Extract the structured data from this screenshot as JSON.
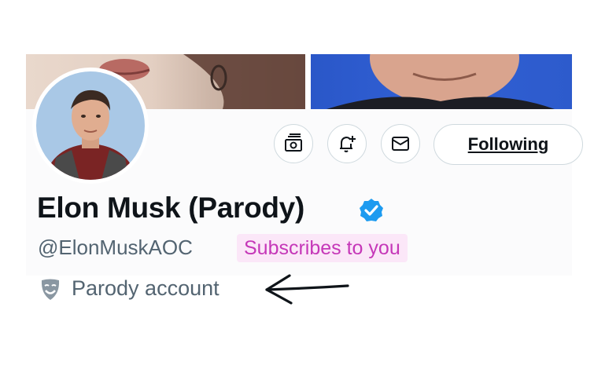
{
  "profile": {
    "display_name": "Elon Musk (Parody)",
    "handle": "@ElonMuskAOC",
    "subscribes_label": "Subscribes to you",
    "parody_label": "Parody account",
    "verified": true
  },
  "actions": {
    "following_label": "Following",
    "icons": [
      "subscription-icon",
      "notification-bell-icon",
      "message-icon"
    ]
  },
  "colors": {
    "verified_blue": "#1d9bf0",
    "subscribes_bg": "#fbe7f8",
    "subscribes_text": "#c537b8",
    "secondary_text": "#536471"
  }
}
